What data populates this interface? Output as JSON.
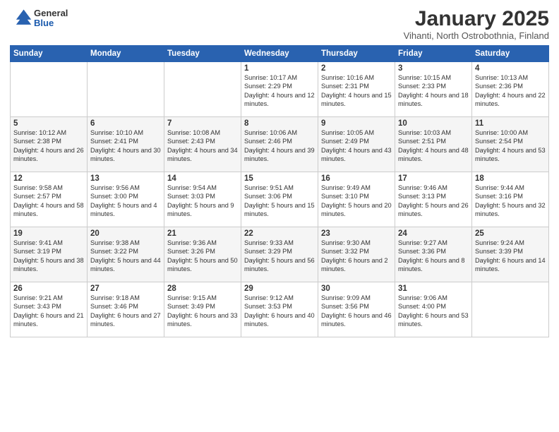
{
  "header": {
    "logo_general": "General",
    "logo_blue": "Blue",
    "title": "January 2025",
    "subtitle": "Vihanti, North Ostrobothnia, Finland"
  },
  "weekdays": [
    "Sunday",
    "Monday",
    "Tuesday",
    "Wednesday",
    "Thursday",
    "Friday",
    "Saturday"
  ],
  "weeks": [
    [
      {
        "day": "",
        "info": ""
      },
      {
        "day": "",
        "info": ""
      },
      {
        "day": "",
        "info": ""
      },
      {
        "day": "1",
        "info": "Sunrise: 10:17 AM\nSunset: 2:29 PM\nDaylight: 4 hours\nand 12 minutes."
      },
      {
        "day": "2",
        "info": "Sunrise: 10:16 AM\nSunset: 2:31 PM\nDaylight: 4 hours\nand 15 minutes."
      },
      {
        "day": "3",
        "info": "Sunrise: 10:15 AM\nSunset: 2:33 PM\nDaylight: 4 hours\nand 18 minutes."
      },
      {
        "day": "4",
        "info": "Sunrise: 10:13 AM\nSunset: 2:36 PM\nDaylight: 4 hours\nand 22 minutes."
      }
    ],
    [
      {
        "day": "5",
        "info": "Sunrise: 10:12 AM\nSunset: 2:38 PM\nDaylight: 4 hours\nand 26 minutes."
      },
      {
        "day": "6",
        "info": "Sunrise: 10:10 AM\nSunset: 2:41 PM\nDaylight: 4 hours\nand 30 minutes."
      },
      {
        "day": "7",
        "info": "Sunrise: 10:08 AM\nSunset: 2:43 PM\nDaylight: 4 hours\nand 34 minutes."
      },
      {
        "day": "8",
        "info": "Sunrise: 10:06 AM\nSunset: 2:46 PM\nDaylight: 4 hours\nand 39 minutes."
      },
      {
        "day": "9",
        "info": "Sunrise: 10:05 AM\nSunset: 2:49 PM\nDaylight: 4 hours\nand 43 minutes."
      },
      {
        "day": "10",
        "info": "Sunrise: 10:03 AM\nSunset: 2:51 PM\nDaylight: 4 hours\nand 48 minutes."
      },
      {
        "day": "11",
        "info": "Sunrise: 10:00 AM\nSunset: 2:54 PM\nDaylight: 4 hours\nand 53 minutes."
      }
    ],
    [
      {
        "day": "12",
        "info": "Sunrise: 9:58 AM\nSunset: 2:57 PM\nDaylight: 4 hours\nand 58 minutes."
      },
      {
        "day": "13",
        "info": "Sunrise: 9:56 AM\nSunset: 3:00 PM\nDaylight: 5 hours\nand 4 minutes."
      },
      {
        "day": "14",
        "info": "Sunrise: 9:54 AM\nSunset: 3:03 PM\nDaylight: 5 hours\nand 9 minutes."
      },
      {
        "day": "15",
        "info": "Sunrise: 9:51 AM\nSunset: 3:06 PM\nDaylight: 5 hours\nand 15 minutes."
      },
      {
        "day": "16",
        "info": "Sunrise: 9:49 AM\nSunset: 3:10 PM\nDaylight: 5 hours\nand 20 minutes."
      },
      {
        "day": "17",
        "info": "Sunrise: 9:46 AM\nSunset: 3:13 PM\nDaylight: 5 hours\nand 26 minutes."
      },
      {
        "day": "18",
        "info": "Sunrise: 9:44 AM\nSunset: 3:16 PM\nDaylight: 5 hours\nand 32 minutes."
      }
    ],
    [
      {
        "day": "19",
        "info": "Sunrise: 9:41 AM\nSunset: 3:19 PM\nDaylight: 5 hours\nand 38 minutes."
      },
      {
        "day": "20",
        "info": "Sunrise: 9:38 AM\nSunset: 3:22 PM\nDaylight: 5 hours\nand 44 minutes."
      },
      {
        "day": "21",
        "info": "Sunrise: 9:36 AM\nSunset: 3:26 PM\nDaylight: 5 hours\nand 50 minutes."
      },
      {
        "day": "22",
        "info": "Sunrise: 9:33 AM\nSunset: 3:29 PM\nDaylight: 5 hours\nand 56 minutes."
      },
      {
        "day": "23",
        "info": "Sunrise: 9:30 AM\nSunset: 3:32 PM\nDaylight: 6 hours\nand 2 minutes."
      },
      {
        "day": "24",
        "info": "Sunrise: 9:27 AM\nSunset: 3:36 PM\nDaylight: 6 hours\nand 8 minutes."
      },
      {
        "day": "25",
        "info": "Sunrise: 9:24 AM\nSunset: 3:39 PM\nDaylight: 6 hours\nand 14 minutes."
      }
    ],
    [
      {
        "day": "26",
        "info": "Sunrise: 9:21 AM\nSunset: 3:43 PM\nDaylight: 6 hours\nand 21 minutes."
      },
      {
        "day": "27",
        "info": "Sunrise: 9:18 AM\nSunset: 3:46 PM\nDaylight: 6 hours\nand 27 minutes."
      },
      {
        "day": "28",
        "info": "Sunrise: 9:15 AM\nSunset: 3:49 PM\nDaylight: 6 hours\nand 33 minutes."
      },
      {
        "day": "29",
        "info": "Sunrise: 9:12 AM\nSunset: 3:53 PM\nDaylight: 6 hours\nand 40 minutes."
      },
      {
        "day": "30",
        "info": "Sunrise: 9:09 AM\nSunset: 3:56 PM\nDaylight: 6 hours\nand 46 minutes."
      },
      {
        "day": "31",
        "info": "Sunrise: 9:06 AM\nSunset: 4:00 PM\nDaylight: 6 hours\nand 53 minutes."
      },
      {
        "day": "",
        "info": ""
      }
    ]
  ]
}
